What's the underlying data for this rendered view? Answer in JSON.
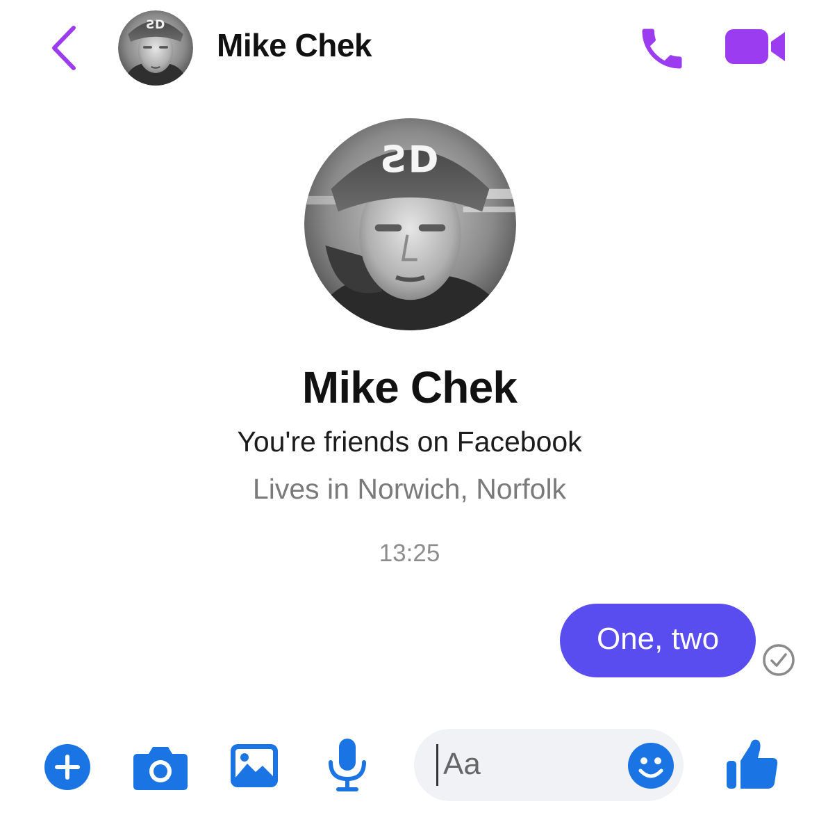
{
  "header": {
    "contact_name": "Mike Chek",
    "back_icon": "chevron-left-icon",
    "call_icon": "phone-icon",
    "video_icon": "video-camera-icon"
  },
  "profile": {
    "name": "Mike Chek",
    "friendship": "You're friends on Facebook",
    "location": "Lives in Norwich, Norfolk",
    "cap_logo": "ƧD"
  },
  "conversation": {
    "timestamp": "13:25",
    "messages": [
      {
        "from": "me",
        "text": "One, two",
        "status_icon": "delivered-check-icon"
      }
    ]
  },
  "composer": {
    "placeholder": "Aa",
    "buttons": [
      "plus-icon",
      "camera-icon",
      "image-icon",
      "microphone-icon",
      "emoji-icon",
      "thumbs-up-icon"
    ]
  },
  "colors": {
    "header_accent": "#9b3cf0",
    "bubble": "#5a4df0",
    "composer_accent": "#1b74e4",
    "input_bg": "#f0f2f5",
    "secondary_text": "#7a7a7a"
  }
}
